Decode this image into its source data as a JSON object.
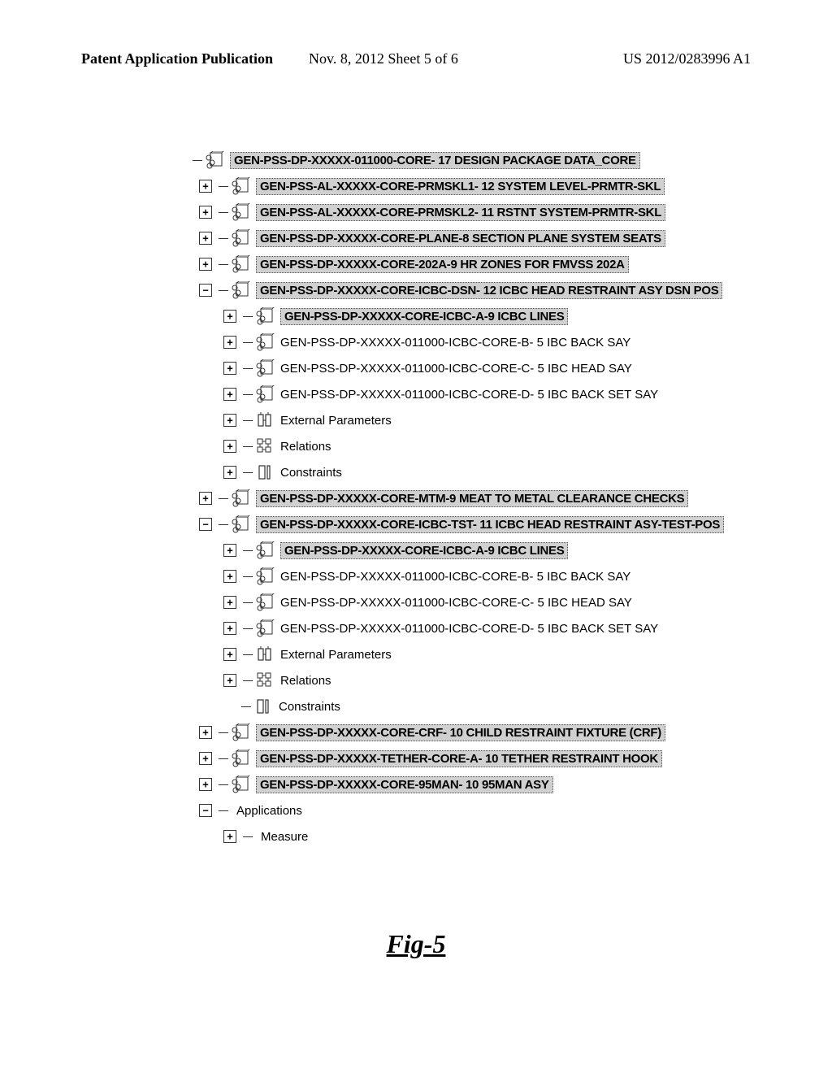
{
  "header": {
    "left": "Patent Application Publication",
    "mid": "Nov. 8, 2012  Sheet 5 of 6",
    "right": "US 2012/0283996 A1"
  },
  "fig_label": "Fig-5",
  "tree": [
    {
      "indent": 0,
      "exp": "",
      "icon": "asm",
      "shaded": true,
      "text": "GEN-PSS-DP-XXXXX-011000-CORE- 17 DESIGN PACKAGE DATA_CORE"
    },
    {
      "indent": 1,
      "exp": "+",
      "icon": "asm",
      "shaded": true,
      "text": "GEN-PSS-AL-XXXXX-CORE-PRMSKL1- 12 SYSTEM LEVEL-PRMTR-SKL"
    },
    {
      "indent": 1,
      "exp": "+",
      "icon": "asm",
      "shaded": true,
      "text": "GEN-PSS-AL-XXXXX-CORE-PRMSKL2- 11 RSTNT SYSTEM-PRMTR-SKL"
    },
    {
      "indent": 1,
      "exp": "+",
      "icon": "asm",
      "shaded": true,
      "text": "GEN-PSS-DP-XXXXX-CORE-PLANE-8 SECTION PLANE SYSTEM SEATS"
    },
    {
      "indent": 1,
      "exp": "+",
      "icon": "asm",
      "shaded": true,
      "text": "GEN-PSS-DP-XXXXX-CORE-202A-9 HR ZONES FOR FMVSS 202A"
    },
    {
      "indent": 1,
      "exp": "-",
      "icon": "asm",
      "shaded": true,
      "text": "GEN-PSS-DP-XXXXX-CORE-ICBC-DSN- 12 ICBC HEAD RESTRAINT ASY DSN POS"
    },
    {
      "indent": 2,
      "exp": "+",
      "icon": "asm",
      "shaded": true,
      "text": "GEN-PSS-DP-XXXXX-CORE-ICBC-A-9 ICBC LINES"
    },
    {
      "indent": 2,
      "exp": "+",
      "icon": "asm",
      "shaded": false,
      "text": "GEN-PSS-DP-XXXXX-011000-ICBC-CORE-B- 5 IBC BACK SAY"
    },
    {
      "indent": 2,
      "exp": "+",
      "icon": "asm",
      "shaded": false,
      "text": "GEN-PSS-DP-XXXXX-011000-ICBC-CORE-C- 5 IBC HEAD SAY"
    },
    {
      "indent": 2,
      "exp": "+",
      "icon": "asm",
      "shaded": false,
      "text": "GEN-PSS-DP-XXXXX-011000-ICBC-CORE-D- 5 IBC BACK SET SAY"
    },
    {
      "indent": 2,
      "exp": "+",
      "icon": "extparam",
      "shaded": false,
      "text": "External Parameters"
    },
    {
      "indent": 2,
      "exp": "+",
      "icon": "rel",
      "shaded": false,
      "text": "Relations"
    },
    {
      "indent": 2,
      "exp": "+",
      "icon": "constraint",
      "shaded": false,
      "text": "Constraints"
    },
    {
      "indent": 1,
      "exp": "+",
      "icon": "asm",
      "shaded": true,
      "text": "GEN-PSS-DP-XXXXX-CORE-MTM-9 MEAT TO METAL CLEARANCE CHECKS"
    },
    {
      "indent": 1,
      "exp": "-",
      "icon": "asm",
      "shaded": true,
      "text": "GEN-PSS-DP-XXXXX-CORE-ICBC-TST- 11 ICBC HEAD RESTRAINT ASY-TEST-POS"
    },
    {
      "indent": 2,
      "exp": "+",
      "icon": "asm",
      "shaded": true,
      "text": "GEN-PSS-DP-XXXXX-CORE-ICBC-A-9 ICBC LINES"
    },
    {
      "indent": 2,
      "exp": "+",
      "icon": "asm",
      "shaded": false,
      "text": "GEN-PSS-DP-XXXXX-011000-ICBC-CORE-B- 5 IBC BACK SAY"
    },
    {
      "indent": 2,
      "exp": "+",
      "icon": "asm",
      "shaded": false,
      "text": "GEN-PSS-DP-XXXXX-011000-ICBC-CORE-C- 5 IBC HEAD SAY"
    },
    {
      "indent": 2,
      "exp": "+",
      "icon": "asm",
      "shaded": false,
      "text": "GEN-PSS-DP-XXXXX-011000-ICBC-CORE-D- 5 IBC BACK SET SAY"
    },
    {
      "indent": 2,
      "exp": "+",
      "icon": "extparam",
      "shaded": false,
      "text": "External Parameters"
    },
    {
      "indent": 2,
      "exp": "+",
      "icon": "rel",
      "shaded": false,
      "text": "Relations"
    },
    {
      "indent": 2,
      "exp": "",
      "icon": "constraint",
      "shaded": false,
      "text": "Constraints"
    },
    {
      "indent": 1,
      "exp": "+",
      "icon": "asm",
      "shaded": true,
      "text": "GEN-PSS-DP-XXXXX-CORE-CRF- 10 CHILD RESTRAINT FIXTURE (CRF)"
    },
    {
      "indent": 1,
      "exp": "+",
      "icon": "asm",
      "shaded": true,
      "text": "GEN-PSS-DP-XXXXX-TETHER-CORE-A- 10 TETHER RESTRAINT HOOK"
    },
    {
      "indent": 1,
      "exp": "+",
      "icon": "asm",
      "shaded": true,
      "text": "GEN-PSS-DP-XXXXX-CORE-95MAN- 10 95MAN ASY"
    },
    {
      "indent": 1,
      "exp": "-",
      "icon": "none",
      "shaded": false,
      "text": "Applications"
    },
    {
      "indent": 2,
      "exp": "+",
      "icon": "none",
      "shaded": false,
      "text": "Measure"
    }
  ]
}
